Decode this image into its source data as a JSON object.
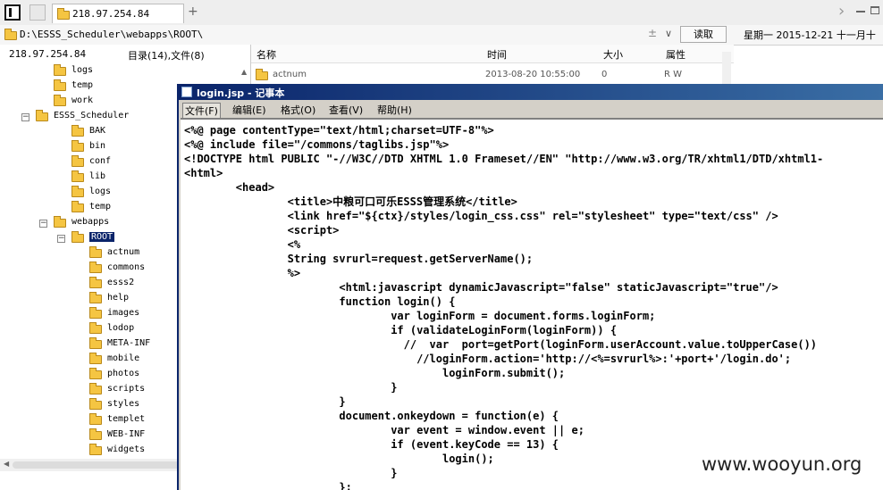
{
  "tabbar": {
    "tab_title": "218.97.254.84",
    "add_tab": "+",
    "nav_next": "›"
  },
  "pathbar": {
    "path": "D:\\ESSS_Scheduler\\webapps\\ROOT\\",
    "pin_symbol": "±",
    "dropdown_symbol": "∨",
    "read_label": "读取",
    "datetime": "星期一 2015-12-21 十一月十"
  },
  "leftpane": {
    "ip": "218.97.254.84",
    "count": "目录(14),文件(8)"
  },
  "tree": [
    {
      "label": "logs"
    },
    {
      "label": "temp"
    },
    {
      "label": "work"
    },
    {
      "label": "ESSS_Scheduler"
    },
    {
      "label": "BAK"
    },
    {
      "label": "bin"
    },
    {
      "label": "conf"
    },
    {
      "label": "lib"
    },
    {
      "label": "logs"
    },
    {
      "label": "temp"
    },
    {
      "label": "webapps"
    },
    {
      "label": "ROOT"
    },
    {
      "label": "actnum"
    },
    {
      "label": "commons"
    },
    {
      "label": "esss2"
    },
    {
      "label": "help"
    },
    {
      "label": "images"
    },
    {
      "label": "lodop"
    },
    {
      "label": "META-INF"
    },
    {
      "label": "mobile"
    },
    {
      "label": "photos"
    },
    {
      "label": "scripts"
    },
    {
      "label": "styles"
    },
    {
      "label": "templet"
    },
    {
      "label": "WEB-INF"
    },
    {
      "label": "widgets"
    }
  ],
  "filelist": {
    "columns": [
      "名称",
      "时间",
      "大小",
      "属性"
    ],
    "rows": [
      {
        "name": "actnum",
        "time": "2013-08-20 10:55:00",
        "size": "0",
        "attr": "R W"
      }
    ]
  },
  "notepad": {
    "title": "login.jsp - 记事本",
    "menu": [
      "文件(F)",
      "编辑(E)",
      "格式(O)",
      "查看(V)",
      "帮助(H)"
    ],
    "lines": [
      "<%@ page contentType=\"text/html;charset=UTF-8\"%>",
      "<%@ include file=\"/commons/taglibs.jsp\"%>",
      "<!DOCTYPE html PUBLIC \"-//W3C//DTD XHTML 1.0 Frameset//EN\" \"http://www.w3.org/TR/xhtml1/DTD/xhtml1-",
      "<html>",
      "        <head>",
      "                <title>中粮可口可乐ESSS管理系统</title>",
      "                <link href=\"${ctx}/styles/login_css.css\" rel=\"stylesheet\" type=\"text/css\" />",
      "                <script>",
      "                <%",
      "                String svrurl=request.getServerName();",
      "                %>",
      "                        <html:javascript dynamicJavascript=\"false\" staticJavascript=\"true\"/>",
      "                        function login() {",
      "                                var loginForm = document.forms.loginForm;",
      "                                if (validateLoginForm(loginForm)) {",
      "                                  //  var  port=getPort(loginForm.userAccount.value.toUpperCase())",
      "                                    //loginForm.action='http://<%=svrurl%>:'+port+'/login.do';",
      "                                        loginForm.submit();",
      "                                }",
      "                        }",
      "                        document.onkeydown = function(e) {",
      "                                var event = window.event || e;",
      "                                if (event.keyCode == 13) {",
      "                                        login();",
      "                                }",
      "                        };"
    ]
  },
  "watermark": "www.wooyun.org",
  "colors": {
    "titlebar_start": "#0a246a",
    "titlebar_end": "#3a6ea5",
    "selection": "#0a246a",
    "folder": "#f5c542"
  }
}
